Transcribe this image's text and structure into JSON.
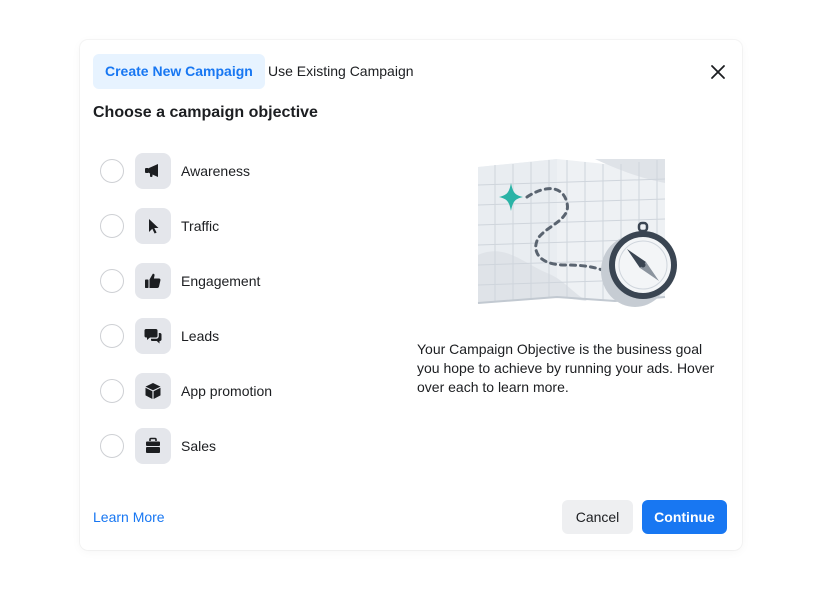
{
  "tabs": {
    "create_label": "Create New Campaign",
    "existing_label": "Use Existing Campaign"
  },
  "heading": "Choose a campaign objective",
  "objectives": [
    {
      "label": "Awareness",
      "icon": "megaphone-icon"
    },
    {
      "label": "Traffic",
      "icon": "cursor-icon"
    },
    {
      "label": "Engagement",
      "icon": "thumbs-up-icon"
    },
    {
      "label": "Leads",
      "icon": "chat-bubbles-icon"
    },
    {
      "label": "App promotion",
      "icon": "box-icon"
    },
    {
      "label": "Sales",
      "icon": "briefcase-icon"
    }
  ],
  "description": "Your Campaign Objective is the business goal you hope to achieve by running your ads. Hover over each to learn more.",
  "footer": {
    "learn_more": "Learn More",
    "cancel": "Cancel",
    "continue": "Continue"
  },
  "colors": {
    "accent": "#1877f2",
    "accent_light": "#e7f3ff",
    "icon_bg": "#e4e6eb",
    "teal": "#2ab3a6"
  }
}
